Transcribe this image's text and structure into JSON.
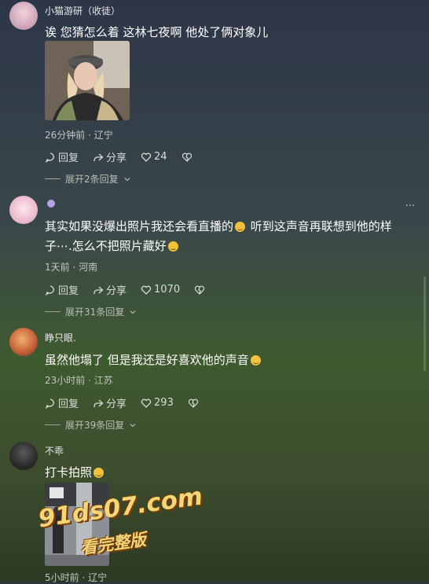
{
  "comments": [
    {
      "username": "小猫游研（收徒）",
      "text": "诶 您猜怎么着 这林七夜啊 他处了俩对象儿",
      "meta": "26分钟前 · 辽宁",
      "reply_label": "回复",
      "share_label": "分享",
      "likes": "24",
      "expand_label": "展开2条回复"
    },
    {
      "username": "",
      "text_part1": "其实如果没爆出照片我还会看直播的",
      "text_part2": "听到这声音再联想到他的样子⋯.怎么不把照片藏好",
      "meta": "1天前 · 河南",
      "reply_label": "回复",
      "share_label": "分享",
      "likes": "1070",
      "expand_label": "展开31条回复",
      "more_label": "···"
    },
    {
      "username": "睁只眼.",
      "text": "虽然他塌了 但是我还是好喜欢他的声音",
      "meta": "23小时前 · 江苏",
      "reply_label": "回复",
      "share_label": "分享",
      "likes": "293",
      "expand_label": "展开39条回复"
    },
    {
      "username": "不乖",
      "text": "打卡拍照",
      "meta": "5小时前 · 辽宁"
    }
  ],
  "watermark": {
    "line1": "91ds07.com",
    "line2": "看完整版"
  },
  "icons": {
    "reply": "comment-bubble-icon",
    "share": "share-arrow-icon",
    "like": "heart-icon",
    "dislike": "broken-heart-icon",
    "expand": "chevron-down-icon"
  }
}
